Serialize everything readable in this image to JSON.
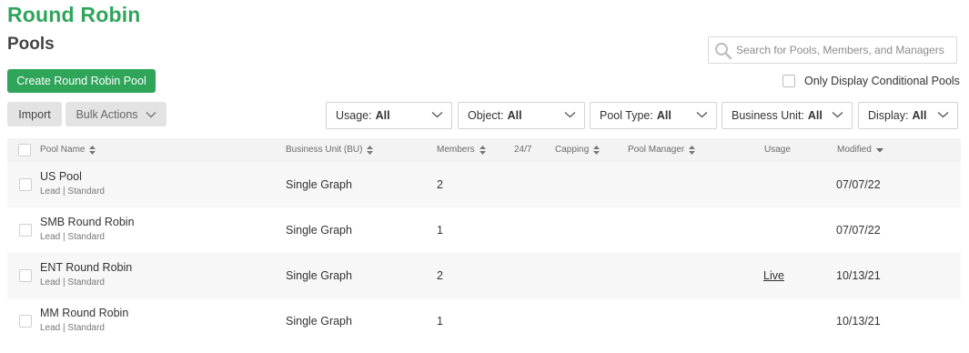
{
  "header": {
    "app_title": "Round Robin",
    "page_title": "Pools"
  },
  "search": {
    "placeholder": "Search for Pools, Members, and Managers",
    "icon": "search-icon"
  },
  "toolbar": {
    "create_label": "Create Round Robin Pool",
    "conditional_label": "Only Display Conditional Pools",
    "import_label": "Import",
    "bulk_label": "Bulk Actions"
  },
  "filters": [
    {
      "label": "Usage:",
      "value": "All"
    },
    {
      "label": "Object:",
      "value": "All"
    },
    {
      "label": "Pool Type:",
      "value": "All"
    },
    {
      "label": "Business Unit:",
      "value": "All"
    },
    {
      "label": "Display:",
      "value": "All"
    }
  ],
  "table": {
    "columns": {
      "pool_name": "Pool Name",
      "business_unit": "Business Unit (BU)",
      "members": "Members",
      "twenty_four_seven": "24/7",
      "capping": "Capping",
      "pool_manager": "Pool Manager",
      "usage": "Usage",
      "modified": "Modified"
    },
    "rows": [
      {
        "name": "US Pool",
        "type": "Lead | Standard",
        "business_unit": "Single Graph",
        "members": "2",
        "usage": "",
        "modified": "07/07/22"
      },
      {
        "name": "SMB Round Robin",
        "type": "Lead | Standard",
        "business_unit": "Single Graph",
        "members": "1",
        "usage": "",
        "modified": "07/07/22"
      },
      {
        "name": "ENT Round Robin",
        "type": "Lead | Standard",
        "business_unit": "Single Graph",
        "members": "2",
        "usage": "Live",
        "modified": "10/13/21"
      },
      {
        "name": "MM Round Robin",
        "type": "Lead | Standard",
        "business_unit": "Single Graph",
        "members": "1",
        "usage": "",
        "modified": "10/13/21"
      }
    ]
  },
  "colors": {
    "accent": "#2fa55a",
    "header_bg": "#f3f3f3",
    "alt_row_bg": "#f7f7f7"
  }
}
